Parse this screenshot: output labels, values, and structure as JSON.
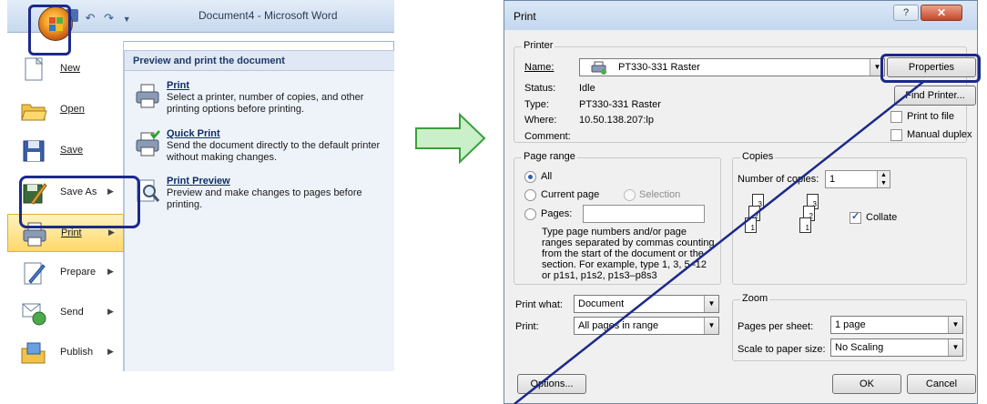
{
  "word": {
    "title": "Document4 - Microsoft Word",
    "menu_items": [
      {
        "label": "New",
        "icon": "new-document-icon",
        "arrow": ""
      },
      {
        "label": "Open",
        "icon": "folder-open-icon",
        "arrow": ""
      },
      {
        "label": "Save",
        "icon": "save-icon",
        "arrow": ""
      },
      {
        "label": "Save As",
        "icon": "save-as-icon",
        "arrow": "▶"
      },
      {
        "label": "Print",
        "icon": "printer-icon",
        "arrow": "▶"
      },
      {
        "label": "Prepare",
        "icon": "prepare-icon",
        "arrow": "▶"
      },
      {
        "label": "Send",
        "icon": "send-icon",
        "arrow": "▶"
      },
      {
        "label": "Publish",
        "icon": "publish-icon",
        "arrow": "▶"
      }
    ],
    "panel": {
      "heading": "Preview and print the document",
      "options": [
        {
          "title": "Print",
          "desc": "Select a printer, number of copies, and other printing options before printing."
        },
        {
          "title": "Quick Print",
          "desc": "Send the document directly to the default printer without making changes."
        },
        {
          "title": "Print Preview",
          "desc": "Preview and make changes to pages before printing."
        }
      ]
    }
  },
  "dialog": {
    "title": "Print",
    "help": "?",
    "close": "✕",
    "printer": {
      "group_label": "Printer",
      "name_label": "Name:",
      "name_value": "PT330-331 Raster",
      "status_label": "Status:",
      "status_value": "Idle",
      "type_label": "Type:",
      "type_value": "PT330-331 Raster",
      "where_label": "Where:",
      "where_value": "10.50.138.207:lp",
      "comment_label": "Comment:",
      "properties_button": "Properties",
      "find_printer_button": "Find Printer...",
      "print_to_file": "Print to file",
      "manual_duplex": "Manual duplex"
    },
    "page_range": {
      "group_label": "Page range",
      "all": "All",
      "current_page": "Current page",
      "selection": "Selection",
      "pages": "Pages:",
      "help_text": "Type page numbers and/or page ranges separated by commas counting from the start of the document or the section. For example, type 1, 3, 5–12 or p1s1, p1s2, p1s3–p8s3"
    },
    "copies": {
      "group_label": "Copies",
      "number_label": "Number of copies:",
      "number_value": "1",
      "collate": "Collate",
      "page_numbers": [
        "3",
        "2",
        "1",
        "3",
        "2",
        "1"
      ]
    },
    "print_what_label": "Print what:",
    "print_what_value": "Document",
    "print_label": "Print:",
    "print_value": "All pages in range",
    "zoom": {
      "group_label": "Zoom",
      "pages_per_sheet_label": "Pages per sheet:",
      "pages_per_sheet_value": "1 page",
      "scale_label": "Scale to paper size:",
      "scale_value": "No Scaling"
    },
    "options_button": "Options...",
    "ok_button": "OK",
    "cancel_button": "Cancel"
  }
}
